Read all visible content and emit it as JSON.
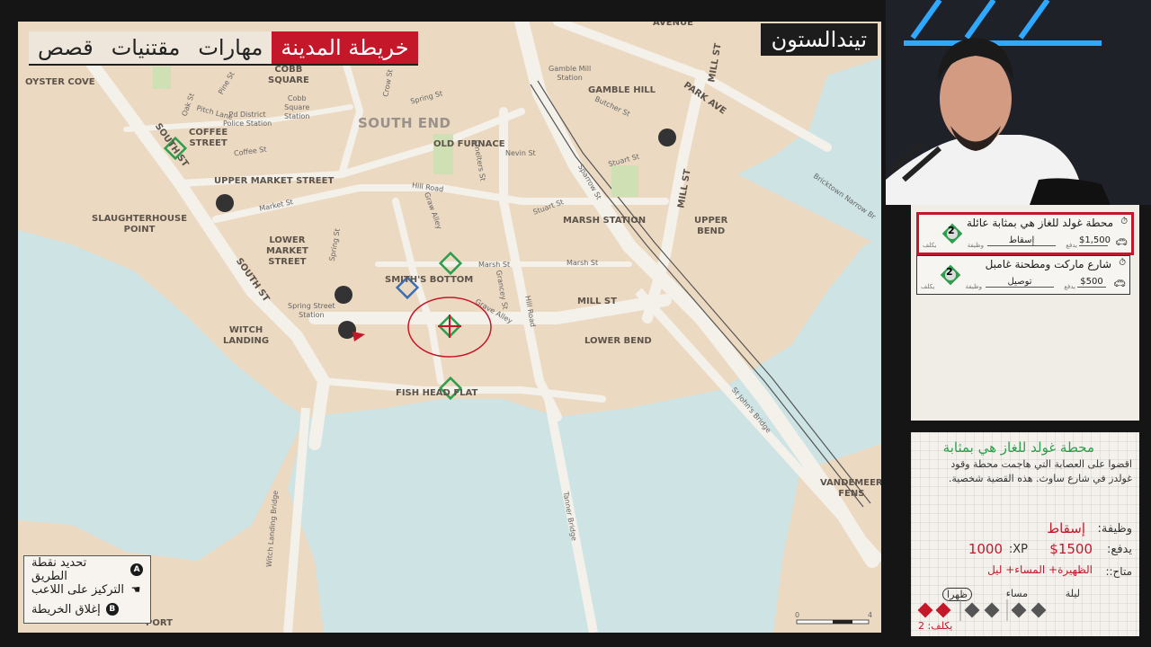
{
  "tabs": [
    "خريطة المدينة",
    "مهارات",
    "مقتنيات",
    "قصص"
  ],
  "city_name": "تيندالستون",
  "legend": [
    {
      "key": "A",
      "label": "تحديد نقطة الطريق"
    },
    {
      "key": "☚",
      "label": "التركيز على اللاعب"
    },
    {
      "key": "B",
      "label": "إغلاق الخريطة"
    }
  ],
  "map_labels": {
    "oyster_cove": "OYSTER COVE",
    "cobb_square": "COBB\nSQUARE",
    "cobb_square_station": "Cobb\nSquare\nStation",
    "pd_district": "Pd District\nPolice Station",
    "pitch_lane": "Pitch Lane",
    "oak_st": "Oak St",
    "pine_st": "Pine St",
    "crow_st": "Crow St",
    "coffee_street": "COFFEE\nSTREET",
    "coffee_st": "Coffee St",
    "south_end": "SOUTH END",
    "old_furnace": "OLD FURNACE",
    "spring_st": "Spring St",
    "gamble_mill_station": "Gamble Mill\nStation",
    "gamble_hill": "GAMBLE HILL",
    "butcher_st": "Butcher St",
    "park_ave": "PARK AVE",
    "mill_st": "MILL ST",
    "avenue": "AVENUE",
    "upper_market_street": "UPPER MARKET STREET",
    "market_st": "Market St",
    "hill_road": "Hill Road",
    "nevin_st": "Nevin St",
    "stuart_st": "Stuart St",
    "sparrow_st": "Sparrow St",
    "smelters_st": "Smelters St",
    "slaughterhouse_point": "SLAUGHTERHOUSE\nPOINT",
    "lower_market_street": "LOWER\nMARKET\nSTREET",
    "marsh_station": "MARSH STATION",
    "upper_bend": "UPPER\nBEND",
    "bricktown": "Bricktown Narrow Br",
    "smiths_bottom": "SMITH'S BOTTOM",
    "marsh_st": "Marsh St",
    "grave_alley": "Grave Alley",
    "graw_alley": "Graw Alley",
    "grancey_st": "Grancey St",
    "spring_street_station": "Spring Street\nStation",
    "south_st": "SOUTH ST",
    "witch_landing": "WITCH\nLANDING",
    "hill_road_2": "Hill Road",
    "lower_bend": "LOWER BEND",
    "fish_head_flat": "FISH HEAD FLAT",
    "witch_landing_bridge": "Witch Landing Bridge",
    "tanner_bridge": "Tanner Bridge",
    "st_johns_bridge": "St John's Bridge",
    "vandemeer_fens": "VANDEMEER\nFENS",
    "port": "PORT",
    "scale_zero": "0",
    "scale_four": "4"
  },
  "job_cards": [
    {
      "title": "محطة غولد للغاز هي بمثابة عائلة",
      "type": "إسقاط",
      "type_caption": "وظيفة",
      "pay": "$1,500",
      "pay_caption": "يدفع",
      "cost": "2",
      "cost_caption": "يكلف",
      "selected": true
    },
    {
      "title": "شارع ماركت ومطحنة غامبل",
      "type": "توصيل",
      "type_caption": "وظيفة",
      "pay": "$500",
      "pay_caption": "يدفع",
      "cost": "2",
      "cost_caption": "يكلف",
      "selected": false
    }
  ],
  "detail": {
    "title": "محطة غولد للغاز هي بمثابة",
    "description_line1": "اقضوا على العصابة التي هاجمت محطة وقود",
    "description_line2": "غولدز في شارع ساوث. هذه القضية شخصية.",
    "job_caption": "وظيفة:",
    "job_value": "إسقاط",
    "pays_caption": "يدفع:",
    "pays_value": "$1500",
    "xp_caption": "XP:",
    "xp_value": "1000",
    "available_caption": "متاح::",
    "available_value": "الظهيرة+ المساء+ ليل",
    "slots": [
      "ظهرا",
      "مساء",
      "ليلة"
    ],
    "cost_caption": "يكلف: 2"
  },
  "colors": {
    "accent_red": "#c5172a",
    "job_green": "#2d9e4c",
    "water": "#cde3e4",
    "land": "#ecd9c1",
    "road": "#f4f0ea"
  }
}
